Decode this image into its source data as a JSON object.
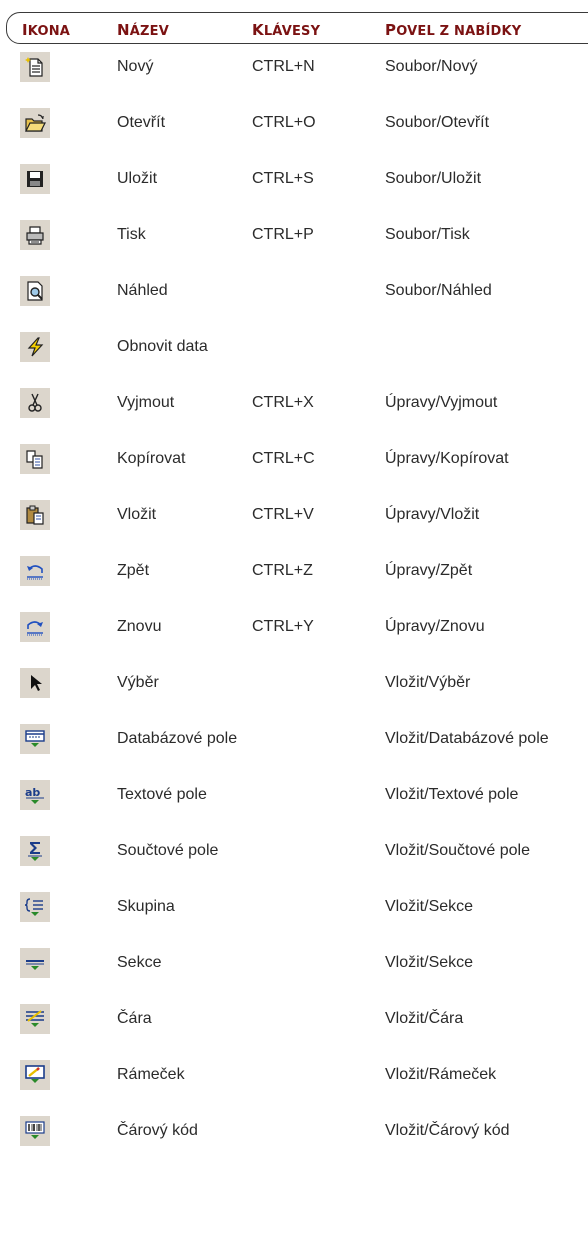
{
  "header": {
    "icon_col": "Ikona",
    "name_col": "Název",
    "keys_col": "Klávesy",
    "cmd_col": "Povel z nabídky"
  },
  "rows": [
    {
      "icon": "new-document-icon",
      "name": "Nový",
      "keys": "CTRL+N",
      "command": "Soubor/Nový"
    },
    {
      "icon": "open-folder-icon",
      "name": "Otevřít",
      "keys": "CTRL+O",
      "command": "Soubor/Otevřít"
    },
    {
      "icon": "save-disk-icon",
      "name": "Uložit",
      "keys": "CTRL+S",
      "command": "Soubor/Uložit"
    },
    {
      "icon": "printer-icon",
      "name": "Tisk",
      "keys": "CTRL+P",
      "command": "Soubor/Tisk"
    },
    {
      "icon": "print-preview-icon",
      "name": "Náhled",
      "keys": "",
      "command": "Soubor/Náhled"
    },
    {
      "icon": "lightning-refresh-icon",
      "name": "Obnovit data",
      "keys": "",
      "command": ""
    },
    {
      "icon": "scissors-icon",
      "name": "Vyjmout",
      "keys": "CTRL+X",
      "command": "Úpravy/Vyjmout"
    },
    {
      "icon": "copy-icon",
      "name": "Kopírovat",
      "keys": "CTRL+C",
      "command": "Úpravy/Kopírovat"
    },
    {
      "icon": "paste-clipboard-icon",
      "name": "Vložit",
      "keys": "CTRL+V",
      "command": "Úpravy/Vložit"
    },
    {
      "icon": "undo-icon",
      "name": "Zpět",
      "keys": "CTRL+Z",
      "command": "Úpravy/Zpět"
    },
    {
      "icon": "redo-icon",
      "name": "Znovu",
      "keys": "CTRL+Y",
      "command": "Úpravy/Znovu"
    },
    {
      "icon": "pointer-arrow-icon",
      "name": "Výběr",
      "keys": "",
      "command": "Vložit/Výběr"
    },
    {
      "icon": "database-field-icon",
      "name": "Databázové pole",
      "keys": "",
      "command": "Vložit/Databázové pole"
    },
    {
      "icon": "text-field-icon",
      "name": "Textové pole",
      "keys": "",
      "command": "Vložit/Textové pole"
    },
    {
      "icon": "sum-field-icon",
      "name": "Součtové pole",
      "keys": "",
      "command": "Vložit/Součtové pole"
    },
    {
      "icon": "group-icon",
      "name": "Skupina",
      "keys": "",
      "command": "Vložit/Sekce"
    },
    {
      "icon": "section-icon",
      "name": "Sekce",
      "keys": "",
      "command": "Vložit/Sekce"
    },
    {
      "icon": "line-icon",
      "name": "Čára",
      "keys": "",
      "command": "Vložit/Čára"
    },
    {
      "icon": "frame-icon",
      "name": "Rámeček",
      "keys": "",
      "command": "Vložit/Rámeček"
    },
    {
      "icon": "barcode-icon",
      "name": "Čárový kód",
      "keys": "",
      "command": "Vložit/Čárový kód"
    }
  ],
  "colors": {
    "header_text": "#7b1212",
    "icon_background": "#dcd6cc",
    "body_text": "#2b2b2b"
  }
}
